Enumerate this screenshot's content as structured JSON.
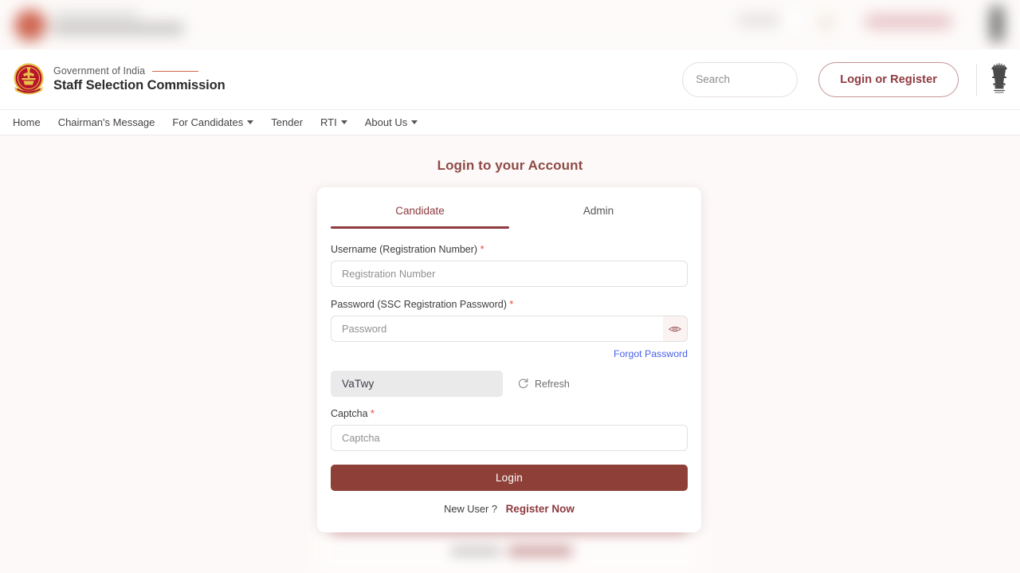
{
  "header": {
    "government_line": "Government of India",
    "organization": "Staff Selection Commission",
    "logo_icon": "ssc-emblem-icon",
    "emblem_icon": "ashoka-emblem-icon",
    "search": {
      "placeholder": "Search",
      "value": "",
      "icon": "search-icon"
    },
    "login_register_label": "Login or Register"
  },
  "nav": {
    "items": [
      {
        "label": "Home",
        "has_dropdown": false
      },
      {
        "label": "Chairman's Message",
        "has_dropdown": false
      },
      {
        "label": "For Candidates",
        "has_dropdown": true
      },
      {
        "label": "Tender",
        "has_dropdown": false
      },
      {
        "label": "RTI",
        "has_dropdown": true
      },
      {
        "label": "About Us",
        "has_dropdown": true
      }
    ]
  },
  "main": {
    "page_title": "Login to your Account",
    "tabs": [
      {
        "label": "Candidate",
        "active": true
      },
      {
        "label": "Admin",
        "active": false
      }
    ],
    "username": {
      "label": "Username (Registration Number)",
      "required_mark": "*",
      "placeholder": "Registration Number",
      "value": ""
    },
    "password": {
      "label": "Password (SSC Registration Password)",
      "required_mark": "*",
      "placeholder": "Password",
      "value": "",
      "toggle_icon": "eye-icon"
    },
    "forgot_password_label": "Forgot Password",
    "captcha_image_text": "VaTwy",
    "refresh_label": "Refresh",
    "refresh_icon": "refresh-icon",
    "captcha": {
      "label": "Captcha",
      "required_mark": "*",
      "placeholder": "Captcha",
      "value": ""
    },
    "login_button_label": "Login",
    "new_user_label": "New User ?",
    "register_now_label": "Register Now"
  },
  "colors": {
    "brand_maroon": "#8e3a3f",
    "button_maroon": "#8e4038",
    "accent_orange": "#cf6a4a",
    "link_blue": "#4a62e8",
    "required_red": "#e8453c",
    "page_background": "#fdf9f8"
  }
}
